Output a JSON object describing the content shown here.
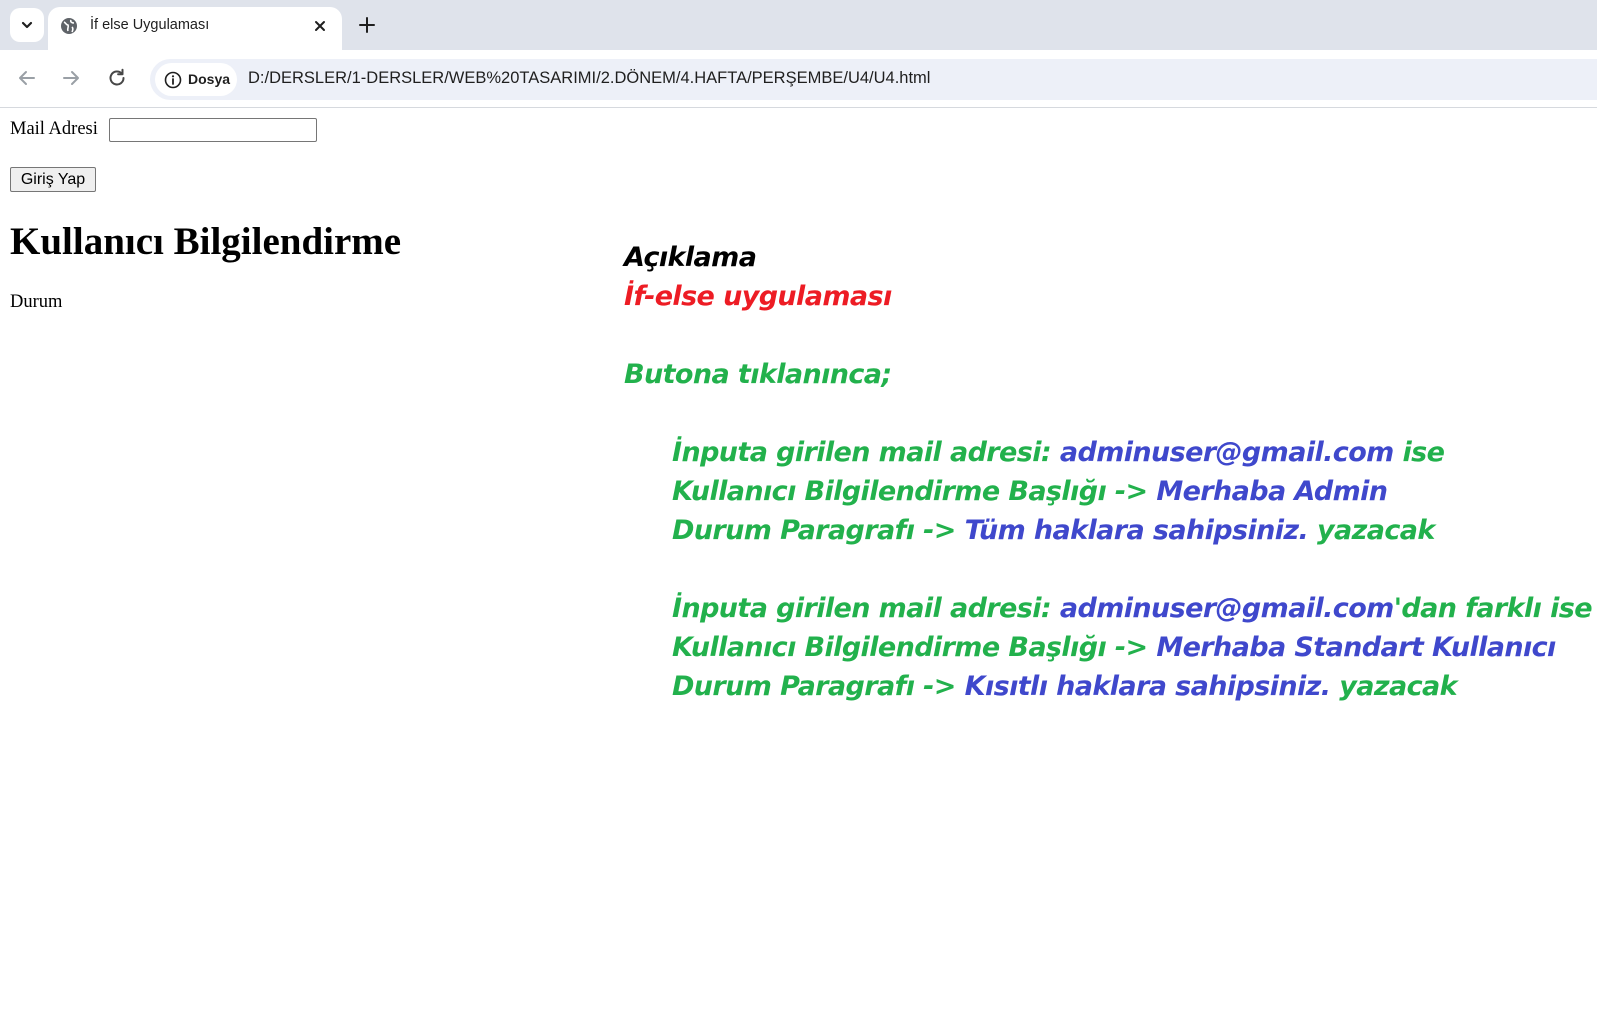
{
  "browser": {
    "tab_title": "İf else Uygulaması",
    "site_chip": "Dosya",
    "url": "D:/DERSLER/1-DERSLER/WEB%20TASARIMI/2.DÖNEM/4.HAFTA/PERŞEMBE/U4/U4.html",
    "icons": {
      "tab_search": "chevron-down-icon",
      "favicon": "globe-icon",
      "close": "close-icon",
      "new_tab": "plus-icon",
      "back": "arrow-left-icon",
      "forward": "arrow-right-icon",
      "reload": "reload-icon",
      "info": "info-icon"
    }
  },
  "form": {
    "mail_label": "Mail Adresi",
    "mail_value": "",
    "login_button": "Giriş Yap"
  },
  "info": {
    "heading": "Kullanıcı Bilgilendirme",
    "status": "Durum"
  },
  "note": {
    "title": "Açıklama",
    "subtitle": "İf-else uygulaması",
    "trigger": "Butona tıklanınca;",
    "case1": {
      "line1_a": "İnputa girilen mail adresi: ",
      "line1_b": "adminuser@gmail.com",
      "line1_c": " ise",
      "line2_a": "Kullanıcı Bilgilendirme Başlığı -> ",
      "line2_b": "Merhaba Admin",
      "line3_a": "Durum Paragrafı -> ",
      "line3_b": "Tüm haklara sahipsiniz.",
      "line3_c": " yazacak"
    },
    "case2": {
      "line1_a": "İnputa girilen mail adresi: ",
      "line1_b": "adminuser@gmail.com",
      "line1_c": "'dan farklı ise",
      "line2_a": "Kullanıcı Bilgilendirme Başlığı -> ",
      "line2_b": "Merhaba Standart Kullanıcı",
      "line3_a": "Durum Paragrafı -> ",
      "line3_b": "Kısıtlı haklara sahipsiniz.",
      "line3_c": " yazacak"
    },
    "colors": {
      "title": "#000000",
      "subtitle": "#ed1c24",
      "instruction": "#22b14c",
      "value": "#3f48cc"
    }
  }
}
